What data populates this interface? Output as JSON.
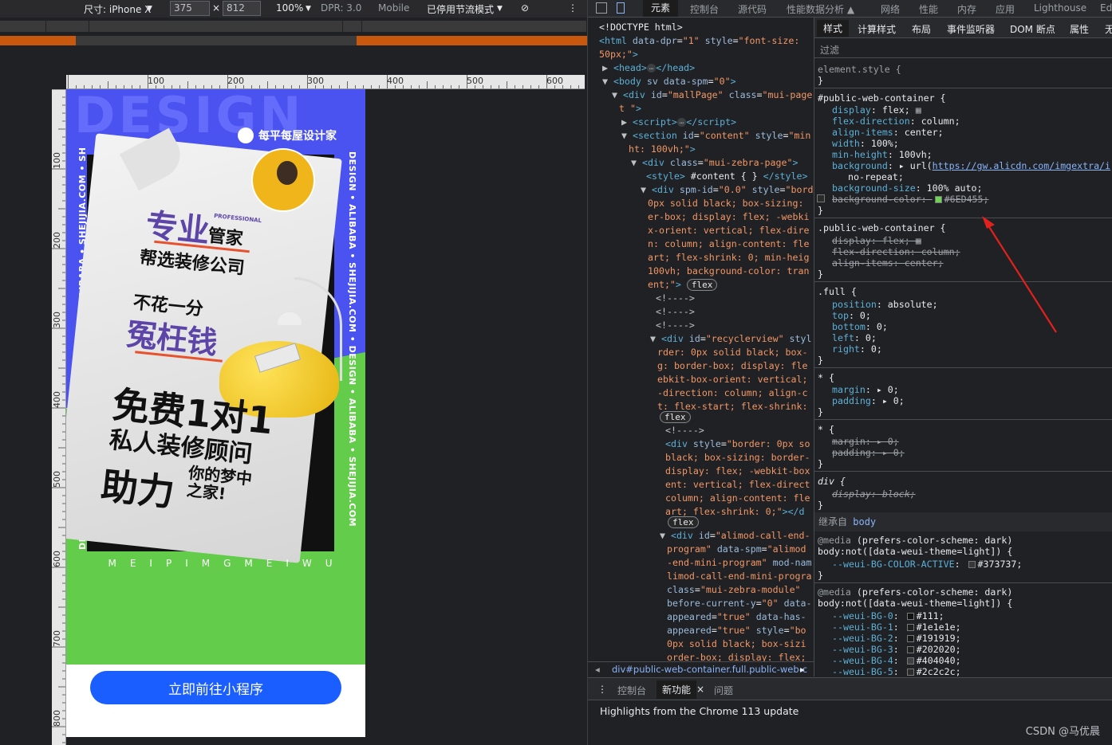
{
  "emulation": {
    "device_label": "尺寸: iPhone X",
    "width_value": "375",
    "times": "×",
    "height_value": "812",
    "zoom": "100%",
    "dpr": "DPR: 3.0",
    "mode": "Mobile",
    "throttle": "已停用节流模式"
  },
  "rulers": {
    "h_labels": [
      "100",
      "200",
      "300",
      "400",
      "500",
      "600"
    ],
    "v_labels": [
      "100",
      "200",
      "300",
      "400",
      "500",
      "600",
      "700",
      "800"
    ]
  },
  "poster": {
    "bg_word": "DESIGN",
    "brand": "每平每屋设计家",
    "side_left": "DESIGN • ALIBABA • SHEJIJIA.COM • DESIGN • ALIBABA • SHEJIJIA.COM • SH",
    "side_right": "DESIGN • ALIBABA • SHEJIJIA.COM • DESIGN • ALIBABA • SHEJIJIA.COM",
    "line1": "专业",
    "line1_tag": "PROFESSIONAL",
    "line1b": "管家",
    "line2": "帮选装修公司",
    "line3": "不花一分",
    "line4": "冤枉钱",
    "line5": "免费1对1",
    "line6": "私人装修顾问",
    "line7": "助力",
    "line8a": "你的梦中",
    "line8b": "之家!",
    "footer_letters": "MEIPIMGMEIWU",
    "cta_label": "立即前往小程序"
  },
  "devtools": {
    "tabs": [
      "元素",
      "控制台",
      "源代码",
      "性能数据分析 ▲",
      "网络",
      "性能",
      "内存",
      "应用",
      "Lighthouse",
      "Ed"
    ],
    "active_tab": "元素",
    "style_tabs": [
      "样式",
      "计算样式",
      "布局",
      "事件监听器",
      "DOM 断点",
      "属性",
      "无"
    ],
    "filter_label": "过滤",
    "breadcrumb": "div#public-web-container.full.public-web-c",
    "drawer_tabs": [
      "控制台",
      "新功能",
      "问题"
    ],
    "drawer_active": "新功能",
    "drawer_close": "×",
    "drawer_message": "Highlights from the Chrome 113 update",
    "watermark": "CSDN @马优晨",
    "inherit_label": "继承自",
    "inherit_target": "body"
  },
  "colors": {
    "poster_blue": "#4a52f0",
    "poster_green": "#63cc4a",
    "cta_blue": "#1a5eff",
    "swatch_green": "#6ED455",
    "devtools_bg": "#202124"
  }
}
